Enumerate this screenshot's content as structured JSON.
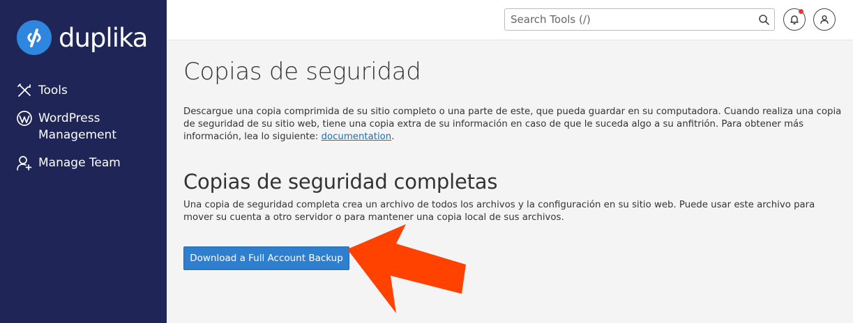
{
  "brand": {
    "name": "duplika",
    "logo_icon": "duplika-logo-icon",
    "accent": "#2e86de"
  },
  "sidebar": {
    "background": "#1f2657",
    "items": [
      {
        "label": "Tools",
        "icon": "tools-icon"
      },
      {
        "label": "WordPress Management",
        "icon": "wordpress-icon"
      },
      {
        "label": "Manage Team",
        "icon": "manage-team-icon"
      }
    ]
  },
  "header": {
    "search": {
      "placeholder": "Search Tools (/)",
      "icon": "search-icon"
    },
    "notifications_icon": "bell-icon",
    "user_icon": "user-icon"
  },
  "main": {
    "title": "Copias de seguridad",
    "intro_text": "Descargue una copia comprimida de su sitio completo o una parte de este, que pueda guardar en su computadora. Cuando realiza una copia de seguridad de su sitio web, tiene una copia extra de su información en caso de que le suceda algo a su anfitrión. Para obtener más información, lea lo siguiente: ",
    "intro_link": "documentation",
    "intro_end": ".",
    "section_title": "Copias de seguridad completas",
    "section_text": "Una copia de seguridad completa crea un archivo de todos los archivos y la configuración en su sitio web. Puede usar este archivo para mover su cuenta a otro servidor o para mantener una copia local de sus archivos.",
    "download_button": "Download a Full Account Backup",
    "button_color": "#2e7fcf"
  },
  "annotation": {
    "icon": "red-arrow-icon",
    "color": "#ff4200"
  }
}
